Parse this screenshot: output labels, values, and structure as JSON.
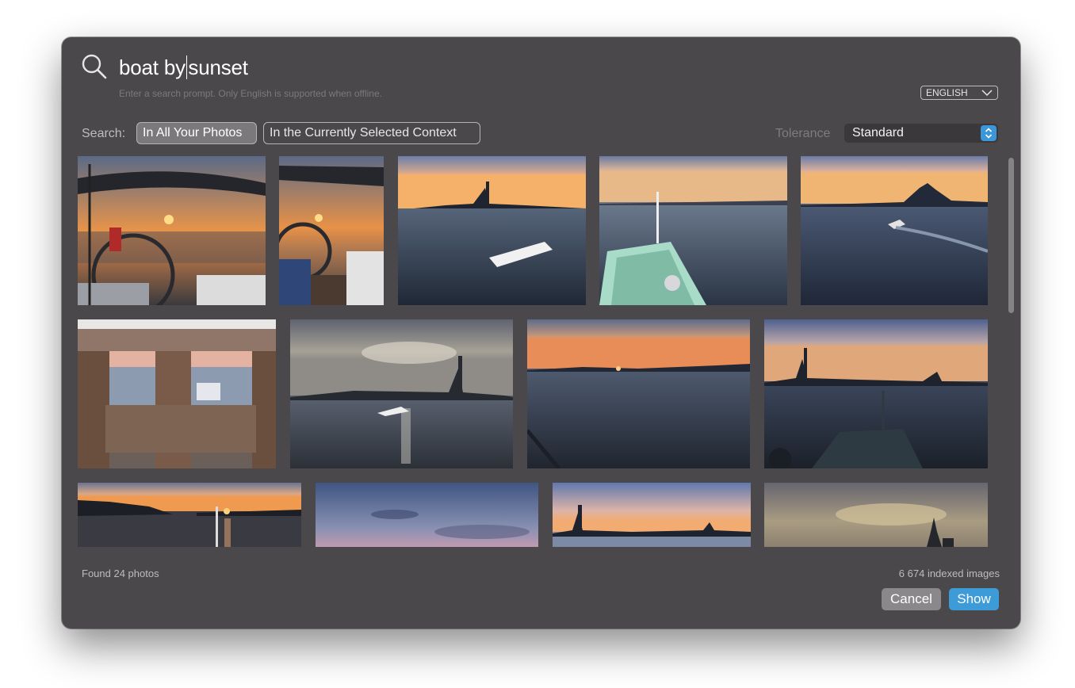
{
  "search": {
    "query_before_caret": "boat by",
    "query_after_caret": "sunset",
    "hint": "Enter a search prompt. Only English is supported when offline."
  },
  "language": {
    "selected": "ENGLISH"
  },
  "scope": {
    "label": "Search:",
    "options": [
      "In All Your Photos",
      "In the Currently Selected Context"
    ],
    "selected": "In All Your Photos"
  },
  "tolerance": {
    "label": "Tolerance",
    "selected": "Standard"
  },
  "results": {
    "found_text": "Found 24 photos",
    "indexed_text": "6 674 indexed images"
  },
  "buttons": {
    "cancel": "Cancel",
    "show": "Show"
  },
  "colors": {
    "panel": "#4a484b",
    "accent": "#3d9bd7",
    "cancel": "#8a888b"
  },
  "photos": [
    {
      "scene": "sailboat-deck-sunset"
    },
    {
      "scene": "sailboat-deck-sunset-2"
    },
    {
      "scene": "motorboat-lagoon-city"
    },
    {
      "scene": "boat-bow-lagoon"
    },
    {
      "scene": "lagoon-wake-city"
    },
    {
      "scene": "wooden-posts-lagoon"
    },
    {
      "scene": "cloudy-sky-motorboat"
    },
    {
      "scene": "sunset-horizon-water"
    },
    {
      "scene": "boat-silhouette-venice"
    },
    {
      "scene": "sunset-harbor-poles"
    },
    {
      "scene": "dusk-sky-clouds"
    },
    {
      "scene": "venice-skyline-dusk"
    },
    {
      "scene": "cloudy-sky-tower"
    }
  ]
}
